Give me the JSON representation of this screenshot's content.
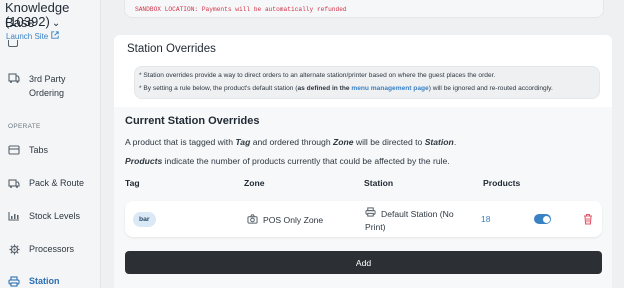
{
  "sidebar": {
    "title": "Knowledge Base",
    "id": "(10392)",
    "launch_site": "Launch Site",
    "section_operate": "OPERATE",
    "items": [
      {
        "label_line1": "3rd Party",
        "label_line2": "Ordering",
        "icon": "third-party-icon"
      },
      {
        "label": "Tabs",
        "icon": "tabs-icon"
      },
      {
        "label": "Pack & Route",
        "icon": "pack-route-icon"
      },
      {
        "label": "Stock Levels",
        "icon": "stock-levels-icon"
      },
      {
        "label": "Processors",
        "icon": "gear-icon"
      },
      {
        "label": "Station",
        "icon": "printer-icon",
        "active": true
      }
    ]
  },
  "sandbox": {
    "text": "SANDBOX LOCATION: Payments will be automatically refunded"
  },
  "panel": {
    "title": "Station Overrides",
    "info": {
      "line1": "* Station overrides provide a way to direct orders to an alternate station/printer based on where the guest places the order.",
      "line2_a": "* By setting a rule below, the product's default station (",
      "line2_b": "as defined in the ",
      "line2_link": "menu management page",
      "line2_c": ") will be ignored and re-routed accordingly."
    }
  },
  "current": {
    "title": "Current Station Overrides",
    "desc1_a": "A product that is tagged with ",
    "desc1_tag": "Tag",
    "desc1_b": " and ordered through ",
    "desc1_zone": "Zone",
    "desc1_c": " will be directed to ",
    "desc1_station": "Station",
    "desc1_d": ".",
    "desc2_products": "Products",
    "desc2_rest": " indicate the number of products currently that could be affected by the rule.",
    "headers": {
      "tag": "Tag",
      "zone": "Zone",
      "station": "Station",
      "products": "Products"
    },
    "rows": [
      {
        "tag": "bar",
        "zone": "POS Only Zone",
        "station_line1": "Default Station (No",
        "station_line2": "Print)",
        "products": "18",
        "enabled": true
      }
    ],
    "add_label": "Add"
  },
  "colors": {
    "accent": "#3b82c4",
    "danger": "#e05a6a",
    "dark_button": "#2c2f33"
  }
}
